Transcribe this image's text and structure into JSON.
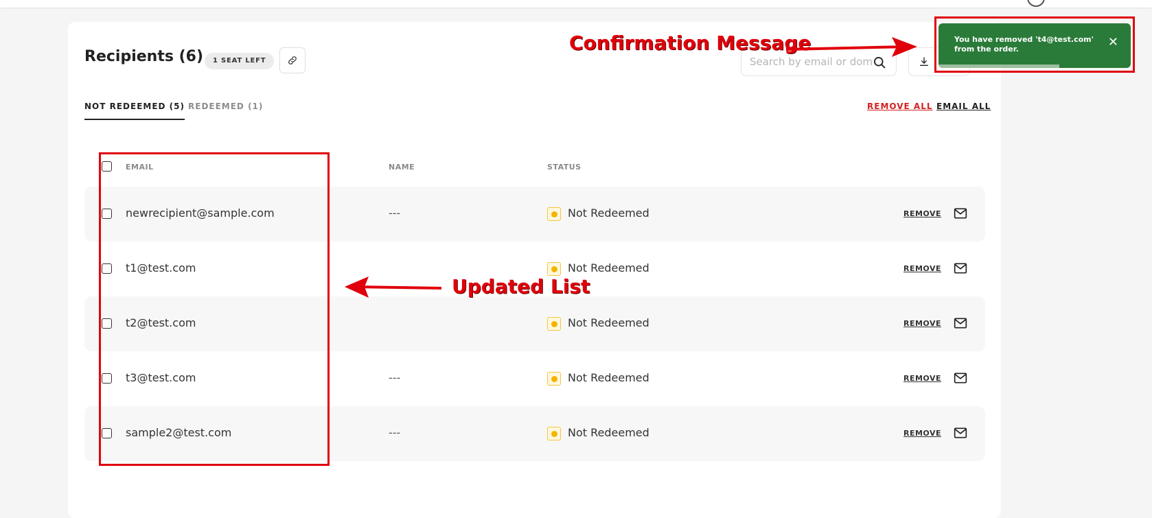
{
  "recipients": {
    "title": "Recipients (6)",
    "seat_badge": "1 SEAT LEFT",
    "search_placeholder": "Search by email or doma"
  },
  "tabs": [
    {
      "label": "NOT REDEEMED (5)",
      "active": true
    },
    {
      "label": "REDEEMED (1)",
      "active": false
    }
  ],
  "actions": {
    "remove_all": "REMOVE ALL",
    "email_all": "EMAIL ALL"
  },
  "table": {
    "columns": [
      "EMAIL",
      "NAME",
      "STATUS"
    ],
    "rows": [
      {
        "email": "newrecipient@sample.com",
        "name": "---",
        "status": "Not Redeemed",
        "remove": "REMOVE"
      },
      {
        "email": "t1@test.com",
        "name": "",
        "status": "Not Redeemed",
        "remove": "REMOVE"
      },
      {
        "email": "t2@test.com",
        "name": "",
        "status": "Not Redeemed",
        "remove": "REMOVE"
      },
      {
        "email": "t3@test.com",
        "name": "---",
        "status": "Not Redeemed",
        "remove": "REMOVE"
      },
      {
        "email": "sample2@test.com",
        "name": "---",
        "status": "Not Redeemed",
        "remove": "REMOVE"
      }
    ]
  },
  "toast": {
    "message": "You have removed 't4@test.com' from the order.",
    "close_glyph": "✕",
    "progress": 0.63,
    "color": "#2a7b39"
  },
  "annotations": {
    "confirmation": "Confirmation Message",
    "updated_list": "Updated List",
    "color": "#e0000b"
  },
  "icons": [
    "link-icon",
    "search-icon",
    "download-icon",
    "mail-icon",
    "close-icon"
  ]
}
